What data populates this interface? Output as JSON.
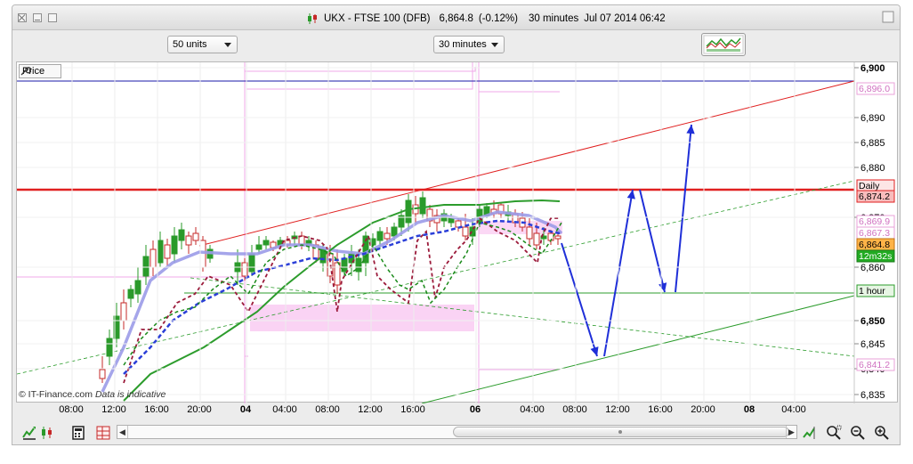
{
  "window": {
    "title": "UKX - FTSE 100 (DFB)",
    "price": "6,864.8",
    "change": "(-0.12%)",
    "interval": "30 minutes",
    "datetime": "Jul 07 2014 06:42"
  },
  "toolbar": {
    "units": "50 units",
    "interval_select": "30 minutes"
  },
  "chart": {
    "price_label": "Price",
    "watermark_brand": "© IT-Finance.com",
    "watermark_note": "Data is indicative",
    "price_axis": [
      {
        "label": "6,900",
        "bold": true
      },
      {
        "label": "6,890",
        "bold": false
      },
      {
        "label": "6,885",
        "bold": false
      },
      {
        "label": "6,880",
        "bold": false
      },
      {
        "label": "6,870",
        "bold": false
      },
      {
        "label": "6,860",
        "bold": false
      },
      {
        "label": "6,850",
        "bold": true
      },
      {
        "label": "6,845",
        "bold": false
      },
      {
        "label": "6,840",
        "bold": false
      },
      {
        "label": "6,835",
        "bold": false
      }
    ],
    "price_tags": [
      {
        "label": "6,896.0",
        "kind": "pink"
      },
      {
        "label": "Daily",
        "kind": "red-outline"
      },
      {
        "label": "6,874.2",
        "kind": "red"
      },
      {
        "label": "6,869.9",
        "kind": "pink"
      },
      {
        "label": "6,867.3",
        "kind": "pink"
      },
      {
        "label": "6,864.8",
        "kind": "orange"
      },
      {
        "label": "12m32s",
        "kind": "green"
      },
      {
        "label": "1 hour",
        "kind": "green-outline"
      },
      {
        "label": "6,841.2",
        "kind": "pink"
      }
    ],
    "time_axis": [
      {
        "label": "08:00",
        "bold": false
      },
      {
        "label": "12:00",
        "bold": false
      },
      {
        "label": "16:00",
        "bold": false
      },
      {
        "label": "20:00",
        "bold": false
      },
      {
        "label": "04",
        "bold": true
      },
      {
        "label": "04:00",
        "bold": false
      },
      {
        "label": "08:00",
        "bold": false
      },
      {
        "label": "12:00",
        "bold": false
      },
      {
        "label": "16:00",
        "bold": false
      },
      {
        "label": "06",
        "bold": true
      },
      {
        "label": "04:00",
        "bold": false
      },
      {
        "label": "08:00",
        "bold": false
      },
      {
        "label": "12:00",
        "bold": false
      },
      {
        "label": "16:00",
        "bold": false
      },
      {
        "label": "20:00",
        "bold": false
      },
      {
        "label": "08",
        "bold": true
      },
      {
        "label": "04:00",
        "bold": false
      }
    ],
    "colors": {
      "up_candle": "#2a9a2a",
      "down_candle": "#c62828",
      "resistance": "#e02020",
      "support": "#2c9c2c",
      "forecast_arrows": "#1f2fd8",
      "moving_average": "#9b9be8",
      "pivot_boxes": "#f0a8e8"
    }
  }
}
